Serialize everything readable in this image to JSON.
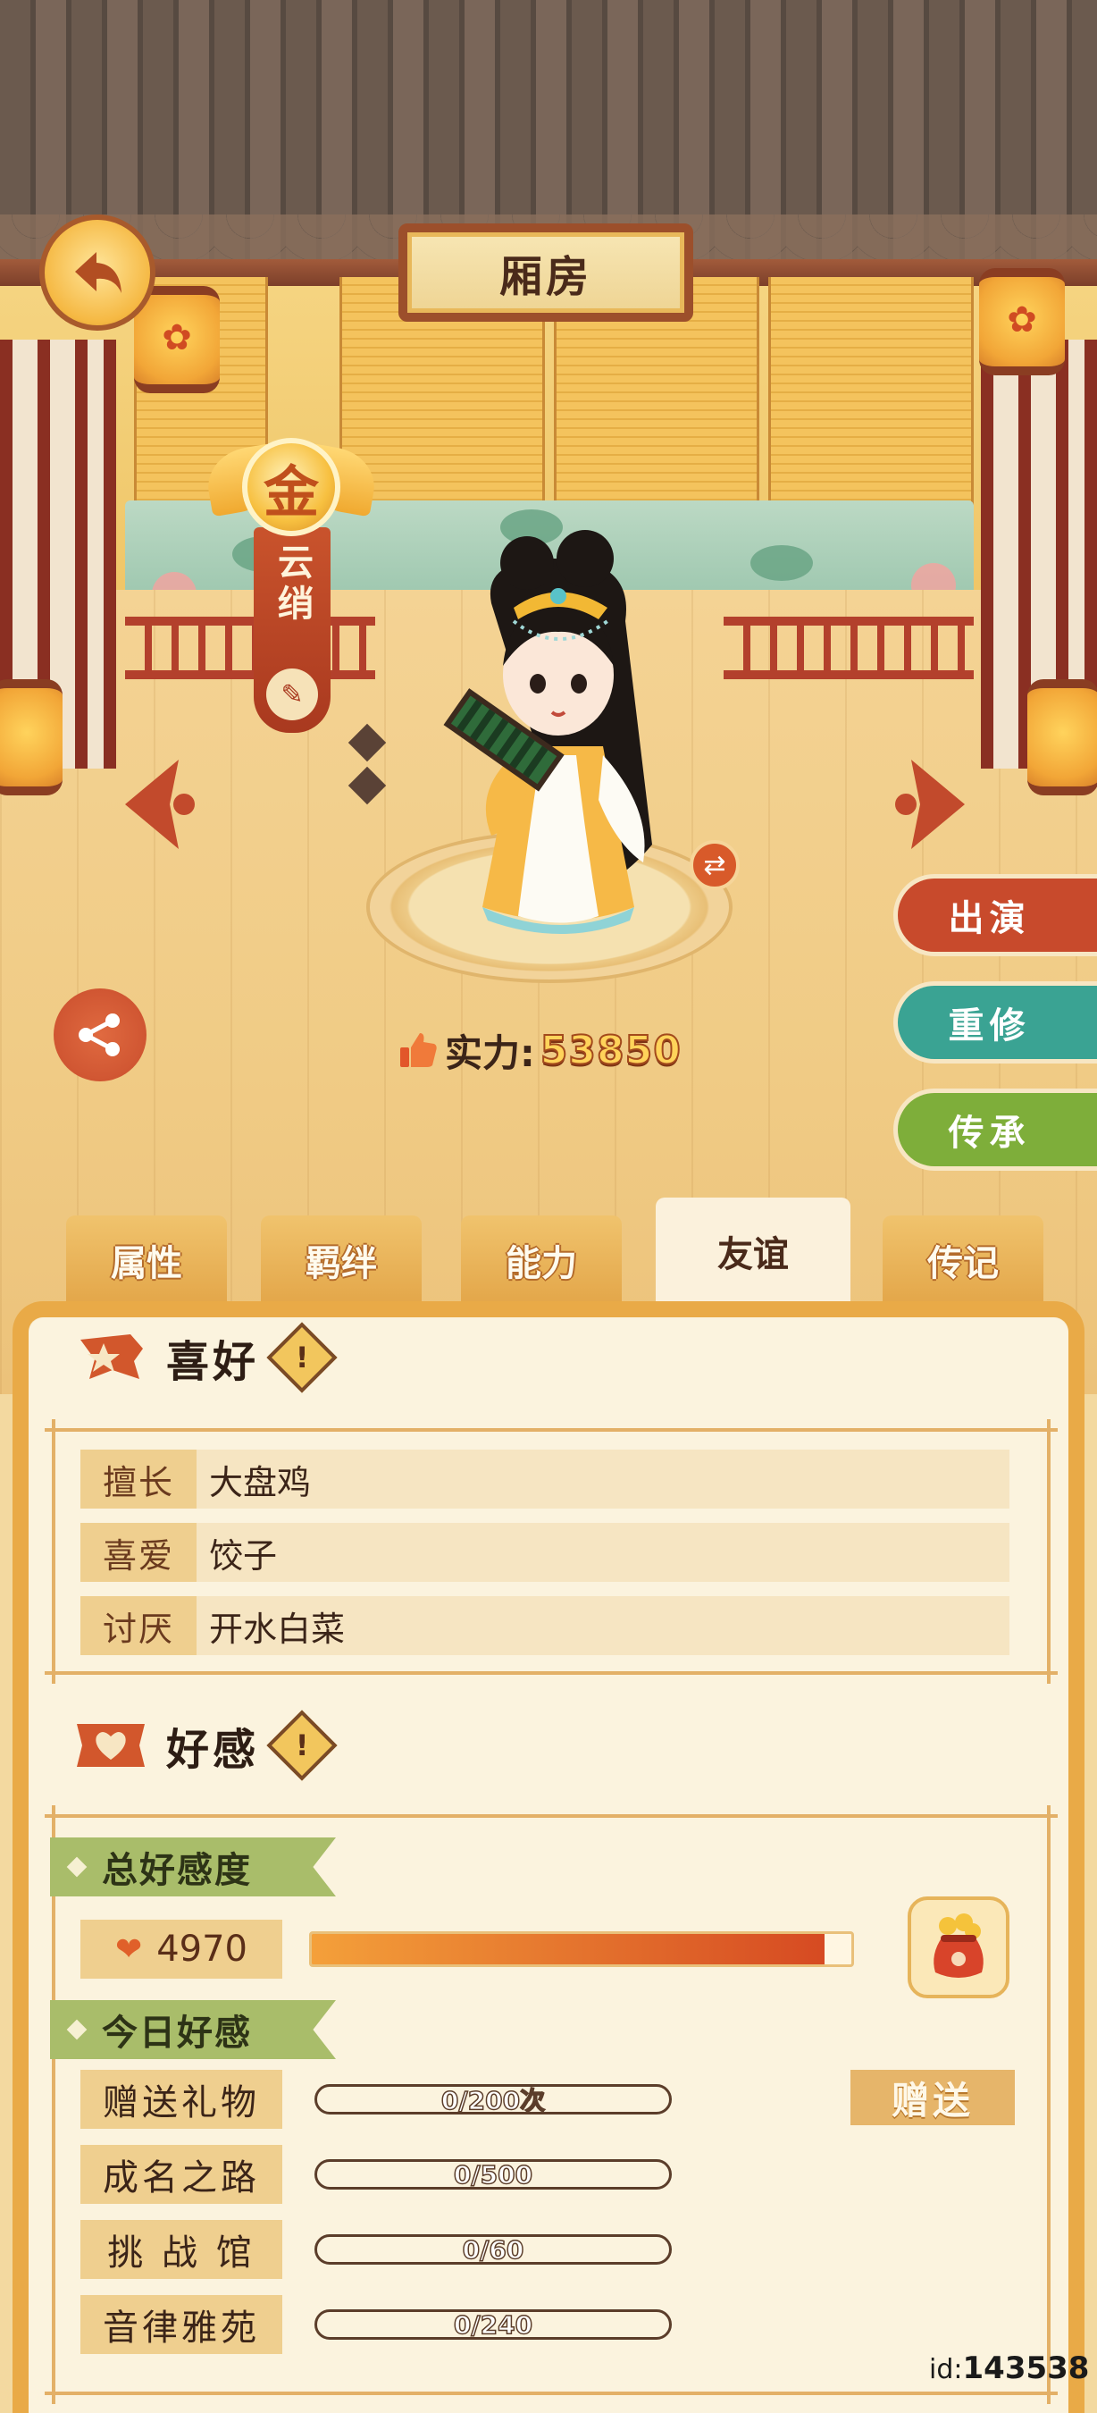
{
  "header": {
    "room_title": "厢房"
  },
  "character": {
    "rank_char": "金",
    "name": "云绡",
    "power_label": "实力:",
    "power_value": "53850"
  },
  "actions": {
    "perform": "出演",
    "retrain": "重修",
    "inherit": "传承"
  },
  "tabs": [
    {
      "label": "属性",
      "active": false
    },
    {
      "label": "羁绊",
      "active": false
    },
    {
      "label": "能力",
      "active": false
    },
    {
      "label": "友谊",
      "active": true
    },
    {
      "label": "传记",
      "active": false
    }
  ],
  "hobby": {
    "title": "喜好",
    "rows": [
      {
        "key": "擅长",
        "value": "大盘鸡"
      },
      {
        "key": "喜爱",
        "value": "饺子"
      },
      {
        "key": "讨厌",
        "value": "开水白菜"
      }
    ]
  },
  "affection": {
    "title": "好感",
    "total_label": "总好感度",
    "total_value": "4970",
    "total_fill": 0.95,
    "today_label": "今日好感",
    "daily": [
      {
        "label": "赠送礼物",
        "progress": "0/200次",
        "fraction": 0
      },
      {
        "label": "成名之路",
        "progress": "0/500",
        "fraction": 0
      },
      {
        "label": "挑 战 馆",
        "progress": "0/60",
        "fraction": 0
      },
      {
        "label": "音律雅苑",
        "progress": "0/240",
        "fraction": 0
      }
    ],
    "give_label": "赠送"
  },
  "footer": {
    "id_prefix": "id:",
    "id_value": "143538"
  },
  "colors": {
    "perform": "#c84a2c",
    "retrain": "#3aa393",
    "inherit": "#7eae3a"
  }
}
